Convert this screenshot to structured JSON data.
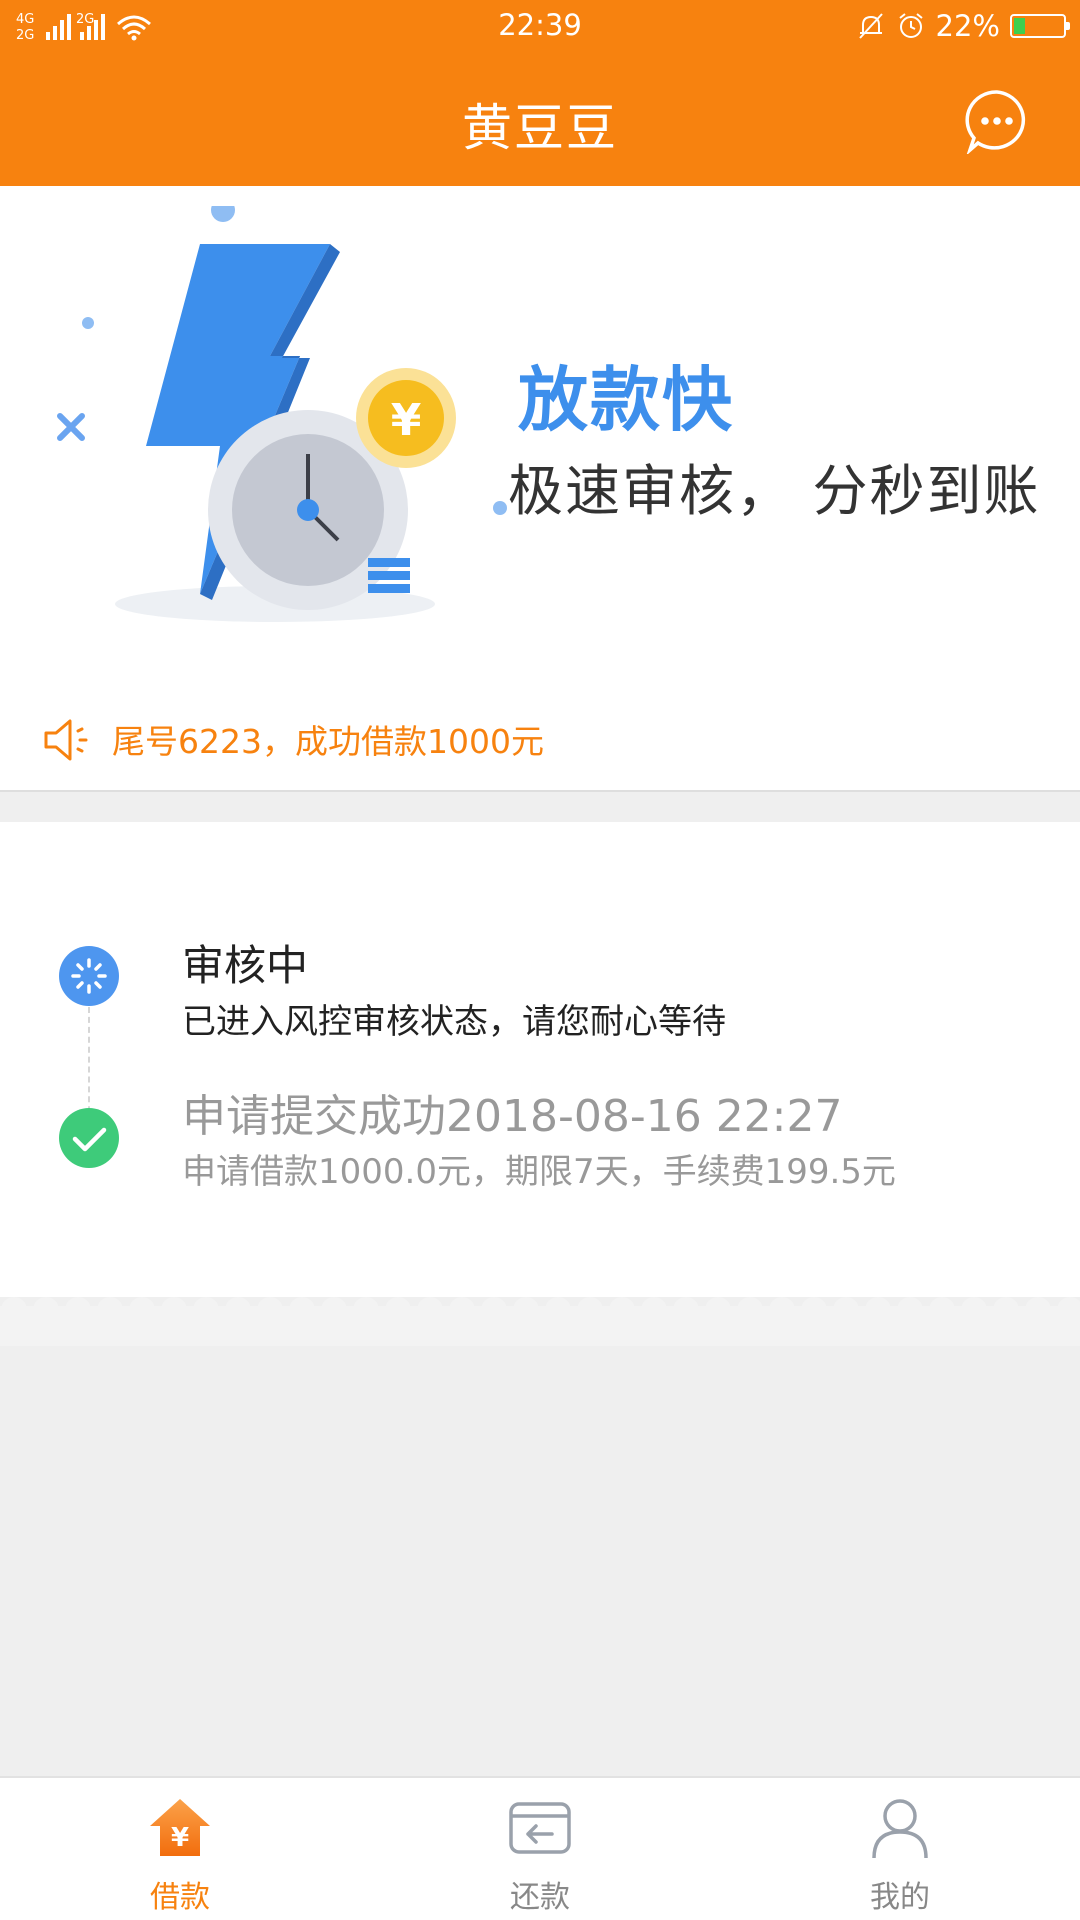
{
  "status_bar": {
    "network_1": "4G",
    "network_2": "2G",
    "network_3": "2G",
    "time": "22:39",
    "battery": "22%",
    "battery_level": 0.22
  },
  "header": {
    "title": "黄豆豆"
  },
  "banner": {
    "headline": "放款快",
    "subtitle": "极速审核， 分秒到账",
    "coin_symbol": "¥"
  },
  "notice": {
    "text": "尾号6223，成功借款1000元"
  },
  "progress": {
    "steps": [
      {
        "title": "审核中",
        "description": "已进入风控审核状态，请您耐心等待",
        "state": "in-progress"
      },
      {
        "title": "申请提交成功2018-08-16 22:27",
        "description": "申请借款1000.0元，期限7天，手续费199.5元",
        "state": "done"
      }
    ]
  },
  "tab_bar": {
    "items": [
      {
        "label": "借款",
        "icon": "borrow-icon",
        "active": true
      },
      {
        "label": "还款",
        "icon": "repay-icon",
        "active": false
      },
      {
        "label": "我的",
        "icon": "profile-icon",
        "active": false
      }
    ]
  },
  "colors": {
    "brand_orange": "#f7820f",
    "accent_blue": "#3d8fec",
    "success_green": "#3ecb7a"
  }
}
